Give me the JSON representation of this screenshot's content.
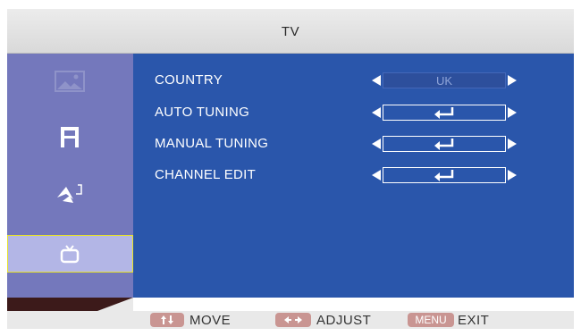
{
  "header": {
    "title": "TV"
  },
  "sidebar": {
    "items": [
      {
        "icon": "picture-icon",
        "selected": false
      },
      {
        "icon": "sound-icon",
        "selected": false
      },
      {
        "icon": "setup-icon",
        "selected": false
      },
      {
        "icon": "tv-icon",
        "selected": true
      }
    ]
  },
  "menu": {
    "rows": [
      {
        "label": "COUNTRY",
        "value": "UK"
      },
      {
        "label": "AUTO TUNING",
        "value": ""
      },
      {
        "label": "MANUAL TUNING",
        "value": ""
      },
      {
        "label": "CHANNEL EDIT",
        "value": ""
      }
    ]
  },
  "footer": {
    "move_label": "MOVE",
    "adjust_label": "ADJUST",
    "menu_badge": "MENU",
    "exit_label": "EXIT"
  },
  "colors": {
    "main_bg": "#2a56ab",
    "sidebar_bg": "#7478bc",
    "selection_border": "#e7e32a",
    "badge": "#c99592"
  }
}
